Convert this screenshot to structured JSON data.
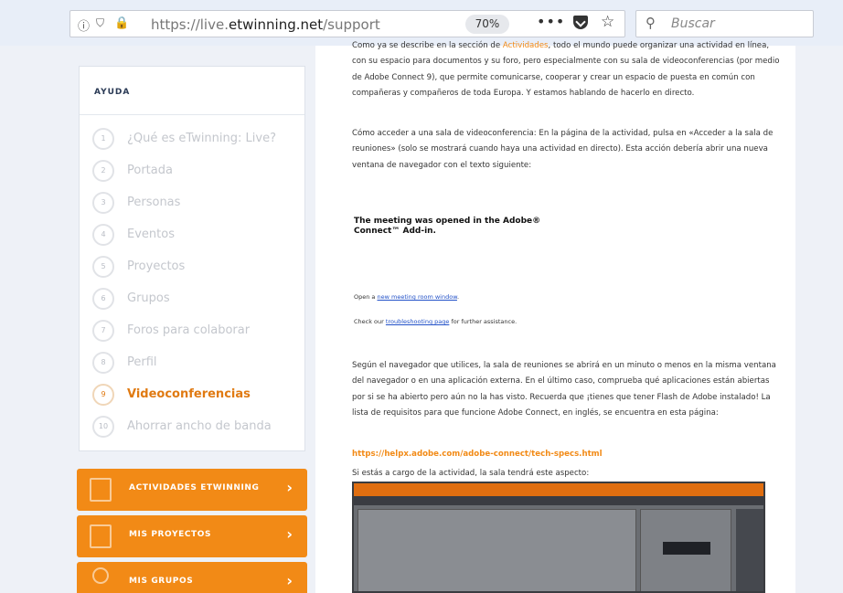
{
  "browser": {
    "url_prefix": "https://live.",
    "url_domain": "etwinning.net",
    "url_path": "/support",
    "zoom": "70%",
    "search_placeholder": "Buscar"
  },
  "sidebar": {
    "title": "AYUDA",
    "items": [
      {
        "num": "1",
        "label": "¿Qué es eTwinning: Live?"
      },
      {
        "num": "2",
        "label": "Portada"
      },
      {
        "num": "3",
        "label": "Personas"
      },
      {
        "num": "4",
        "label": "Eventos"
      },
      {
        "num": "5",
        "label": "Proyectos"
      },
      {
        "num": "6",
        "label": "Grupos"
      },
      {
        "num": "7",
        "label": "Foros para colaborar"
      },
      {
        "num": "8",
        "label": "Perfil"
      },
      {
        "num": "9",
        "label": "Videoconferencias"
      },
      {
        "num": "10",
        "label": "Ahorrar ancho de banda"
      }
    ],
    "buttons": [
      {
        "label": "ACTIVIDADES ETWINNING"
      },
      {
        "label": "MIS PROYECTOS"
      },
      {
        "label": "MIS GRUPOS"
      }
    ]
  },
  "article": {
    "p1_before": "Como ya se describe en la sección de ",
    "p1_highlight": "Actividades",
    "p1_after": ", todo el mundo puede organizar una actividad en línea, con su espacio para documentos y su foro, pero especialmente con su sala de videoconferencias (por medio de Adobe Connect 9), que permite comunicarse, cooperar y crear un espacio de puesta en común con compañeras y compañeros de toda Europa. Y estamos hablando de hacerlo en directo.",
    "p2": "Cómo acceder a una sala de videoconferencia: En la página de la actividad, pulsa en «Acceder a la sala de reuniones» (solo se mostrará cuando haya una actividad en directo). Esta acción debería abrir una nueva ventana de navegador con el texto siguiente:",
    "adobe_line1": "The meeting was opened in the Adobe®",
    "adobe_line2": "Connect™ Add-in.",
    "open_before": "Open a ",
    "open_link": "new meeting room window",
    "open_after": ".",
    "check_before": "Check our ",
    "check_link": "troubleshooting page",
    "check_after": " for further assistance.",
    "p3": "Según el navegador que utilices, la sala de reuniones se abrirá en un minuto o menos en la misma ventana del navegador o en una aplicación externa. En el último caso, comprueba qué aplicaciones están abiertas por si se ha abierto pero aún no la has visto. Recuerda que ¡tienes que tener Flash de Adobe instalado! La lista de requisitos para que funcione Adobe Connect, en inglés, se encuentra en esta página:",
    "tech_link": "https://helpx.adobe.com/adobe-connect/tech-specs.html",
    "p4": "Si estás a cargo de la actividad, la sala tendrá este aspecto:"
  }
}
